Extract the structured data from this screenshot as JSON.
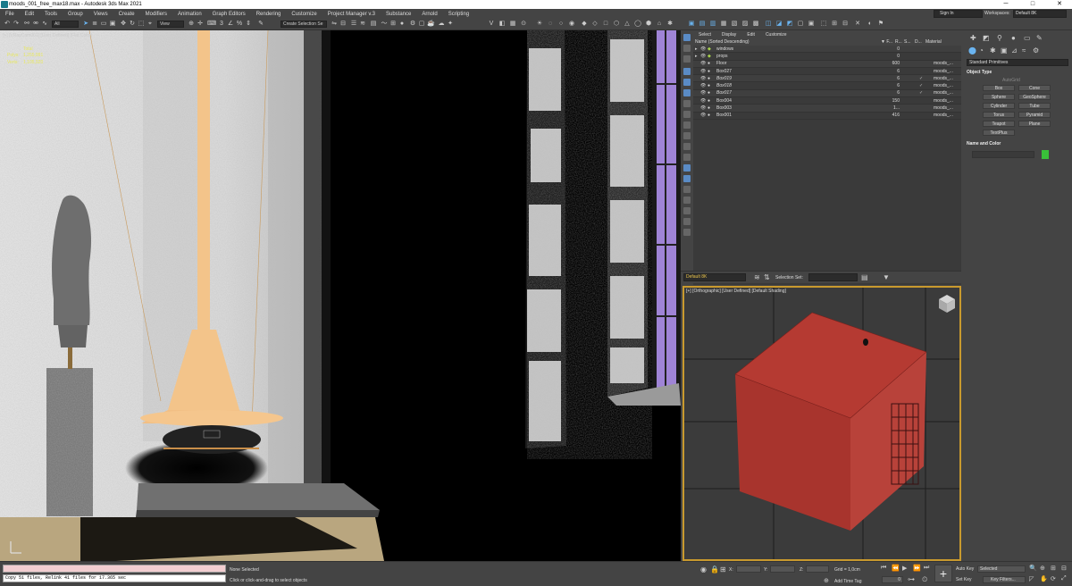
{
  "window": {
    "title": "moods_001_free_max18.max - Autodesk 3ds Max 2021",
    "minimize": "─",
    "maximize": "□",
    "close": "✕"
  },
  "menu": [
    "File",
    "Edit",
    "Tools",
    "Group",
    "Views",
    "Create",
    "Modifiers",
    "Animation",
    "Graph Editors",
    "Rendering",
    "Customize",
    "Project Manager v.3",
    "Substance",
    "Arnold",
    "Scripting"
  ],
  "user": {
    "sign_in": "Sign In",
    "workspaces_label": "Workspaces:",
    "workspace": "Default 8K"
  },
  "toolbar": {
    "filter": "All",
    "view": "View",
    "selection_set_placeholder": "Create Selection Se"
  },
  "viewport": {
    "label": "[+] [VRayCam001] [User Defined] [Flat Color]",
    "stats_total": "Total",
    "stats_polys_label": "Polys:",
    "stats_polys": "1,255,991",
    "stats_verts_label": "Verts:",
    "stats_verts": "1,105,920"
  },
  "scene_explorer": {
    "tabs": [
      "Select",
      "Display",
      "Edit",
      "Customize"
    ],
    "header_name": "Name (Sorted Descending)",
    "header_faces": "▼ F...",
    "header_r": "R...",
    "header_s": "S...",
    "header_d": "D...",
    "header_material": "Material",
    "rows": [
      {
        "name": "windows",
        "faces": "0",
        "material": ""
      },
      {
        "name": "props",
        "faces": "0",
        "material": ""
      },
      {
        "name": "Floor",
        "faces": "600",
        "material": "moods_..."
      },
      {
        "name": "Box027",
        "faces": "6",
        "material": "moods_..."
      },
      {
        "name": "Box019",
        "faces": "6",
        "material": "moods_..."
      },
      {
        "name": "Box018",
        "faces": "6",
        "material": "moods_..."
      },
      {
        "name": "Box017",
        "faces": "6",
        "material": "moods_..."
      },
      {
        "name": "Box004",
        "faces": "150",
        "material": "moods_..."
      },
      {
        "name": "Box003",
        "faces": "1...",
        "material": "moods_..."
      },
      {
        "name": "Box001",
        "faces": "416",
        "material": "moods_..."
      }
    ],
    "layer": "Default 8K",
    "selection_set_label": "Selection Set:"
  },
  "viewport2": {
    "label": "[+] [Orthographic] [User Defined] [Default Shading]"
  },
  "command_panel": {
    "dropdown": "Standard Primitives",
    "object_type": "Object Type",
    "autogrid": "AutoGrid",
    "buttons": [
      "Box",
      "Cone",
      "Sphere",
      "GeoSphere",
      "Cylinder",
      "Tube",
      "Torus",
      "Pyramid",
      "Teapot",
      "Plane",
      "TextPlus"
    ],
    "name_and_color": "Name and Color",
    "color": "#39c039"
  },
  "status": {
    "maxscript": "Copy 51 files, Relink 41 files for 17.365 sec",
    "selected": "None Selected",
    "prompt": "Click or click-and-drag to select objects",
    "x_label": "X:",
    "y_label": "Y:",
    "z_label": "Z:",
    "grid": "Grid = 1,0cm",
    "add_time_tag": "Add Time Tag",
    "frame": "0",
    "auto_key": "Auto Key",
    "set_key": "Set Key",
    "key_mode": "Selected",
    "key_filters": "Key Filters..."
  }
}
